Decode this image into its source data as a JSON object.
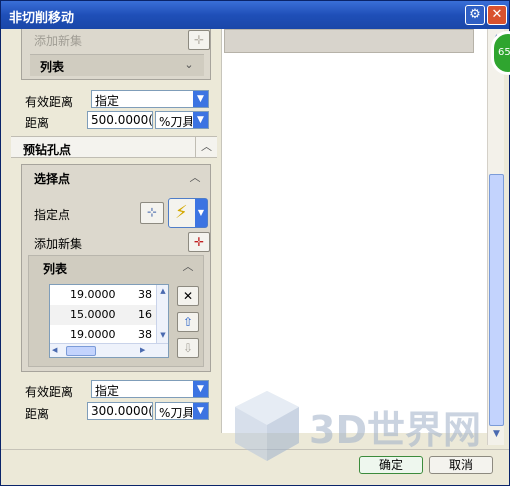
{
  "window": {
    "title": "非切削移动",
    "gear_icon": "gear-icon",
    "close_icon": "close-icon"
  },
  "badge": {
    "text": "65"
  },
  "top_group": {
    "add_new_set_label": "添加新集",
    "list_label": "列表",
    "effective_distance_label": "有效距离",
    "effective_distance_value": "指定",
    "distance_label": "距离",
    "distance_value": "500.0000(",
    "distance_unit": "%刀具"
  },
  "predrill": {
    "header": "预钻孔点",
    "select_points": {
      "header": "选择点",
      "specify_point_label": "指定点",
      "add_new_set_label": "添加新集"
    },
    "list": {
      "header": "列表",
      "rows": [
        {
          "c1": "19.0000",
          "c2": "38"
        },
        {
          "c1": "15.0000",
          "c2": "16"
        },
        {
          "c1": "19.0000",
          "c2": "38"
        }
      ]
    },
    "effective_distance_label": "有效距离",
    "effective_distance_value": "指定",
    "distance_label": "距离",
    "distance_value": "300.0000(",
    "distance_unit": "%刀具"
  },
  "footer": {
    "ok_label": "确定",
    "cancel_label": "取消"
  },
  "watermark": {
    "text": "3D世界网"
  }
}
